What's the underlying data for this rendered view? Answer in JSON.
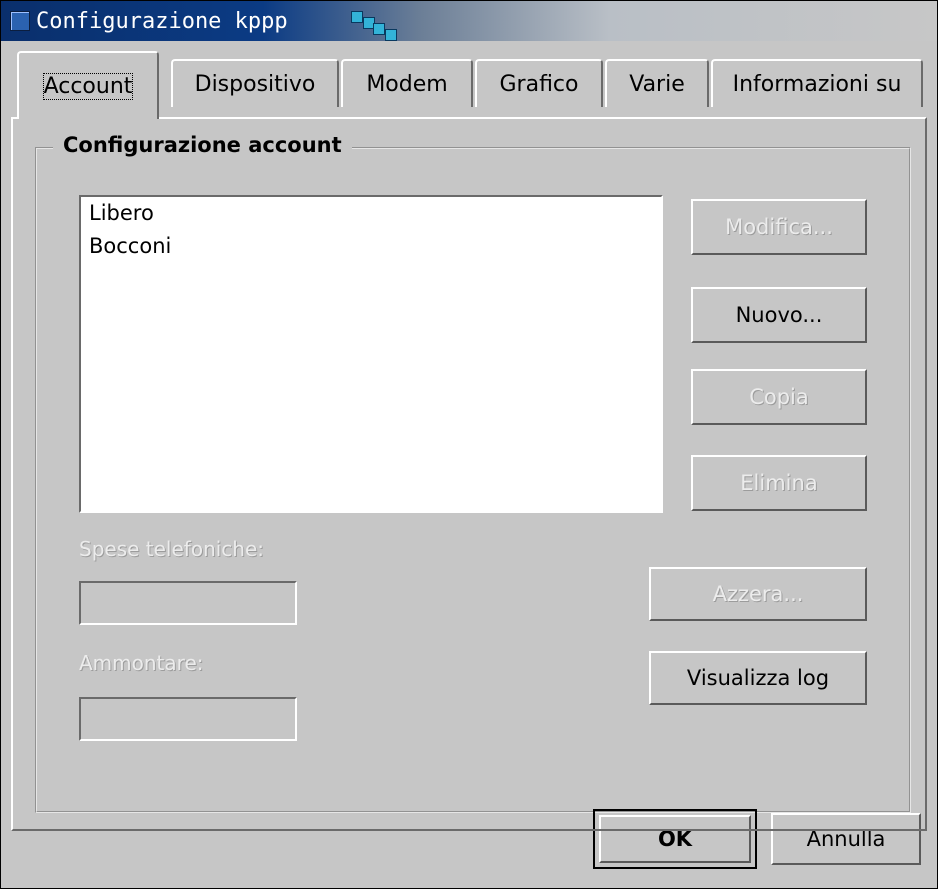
{
  "window": {
    "title": "Configurazione kppp"
  },
  "tabs": [
    {
      "label": "Account",
      "active": true
    },
    {
      "label": "Dispositivo",
      "active": false
    },
    {
      "label": "Modem",
      "active": false
    },
    {
      "label": "Grafico",
      "active": false
    },
    {
      "label": "Varie",
      "active": false
    },
    {
      "label": "Informazioni su",
      "active": false
    }
  ],
  "account": {
    "group_title": "Configurazione account",
    "list_items": [
      "Libero",
      "Bocconi"
    ],
    "buttons": {
      "modifica": "Modifica...",
      "nuovo": "Nuovo...",
      "copia": "Copia",
      "elimina": "Elimina",
      "azzera": "Azzera...",
      "visualizza_log": "Visualizza log"
    },
    "phone_costs_label": "Spese telefoniche:",
    "phone_costs_value": "",
    "amount_label": "Ammontare:",
    "amount_value": ""
  },
  "dialog_buttons": {
    "ok": "OK",
    "cancel": "Annulla"
  },
  "colors": {
    "background": "#c6c6c6",
    "title_gradient_start": "#0a2f6c",
    "title_text": "#ffffff"
  }
}
